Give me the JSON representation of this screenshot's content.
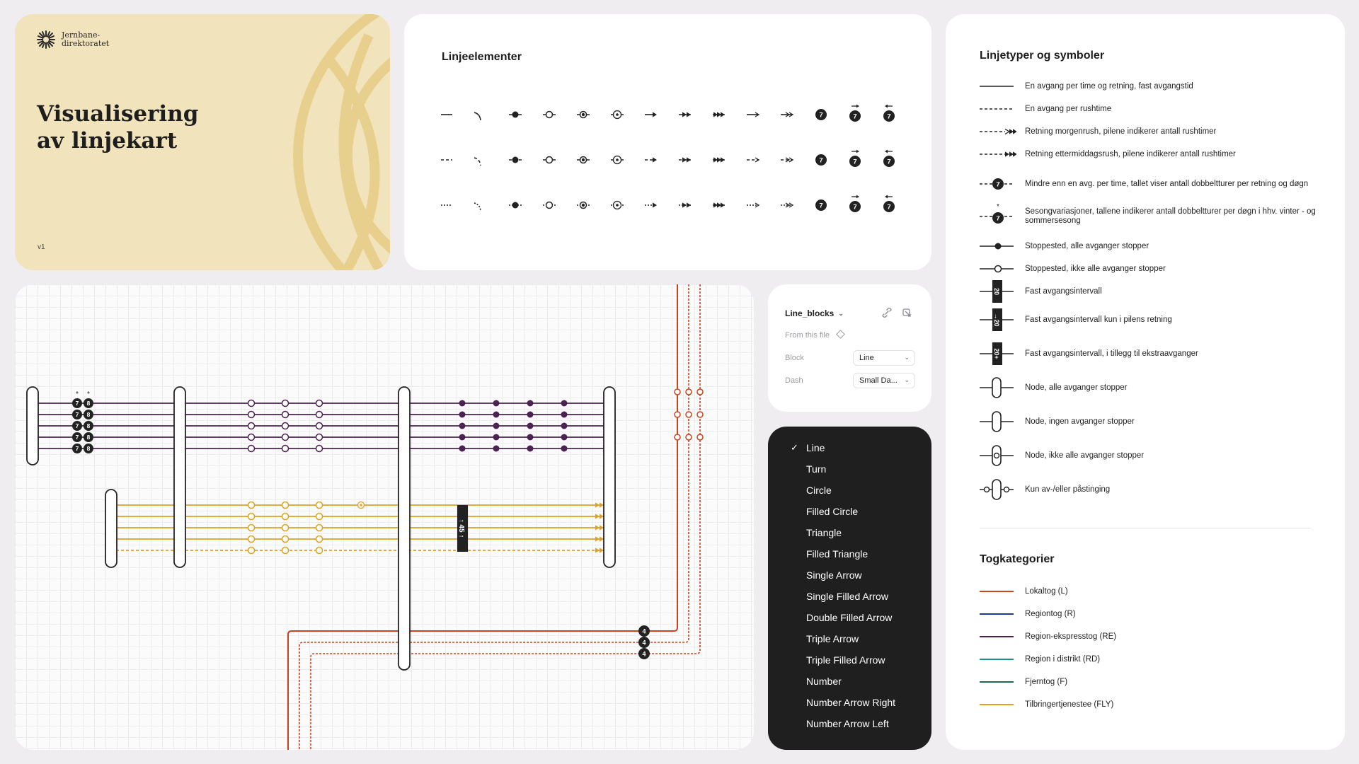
{
  "title_card": {
    "logo_line1": "Jernbane-",
    "logo_line2": "direktoratet",
    "title_line1": "Visualisering",
    "title_line2": "av linjekart",
    "version": "v1",
    "background": "#f1e3bb"
  },
  "elements_card": {
    "title": "Linjeelementer",
    "number_symbol": "7"
  },
  "legend": {
    "line_types_title": "Linjetyper og symboler",
    "line_types": [
      {
        "icon": "solid-line-icon",
        "text": "En avgang per time og retning, fast avgangstid"
      },
      {
        "icon": "dashed-line-icon",
        "text": "En avgang per rushtime"
      },
      {
        "icon": "morning-rush-arrows-icon",
        "text": "Retning morgenrush, pilene indikerer antall rushtimer"
      },
      {
        "icon": "evening-rush-arrows-icon",
        "text": "Retning ettermiddagsrush, pilene indikerer antall rushtimer"
      },
      {
        "icon": "number-circle-icon",
        "text": "Mindre enn en avg. per time, tallet viser antall dobbeltturer per retning og døgn"
      },
      {
        "icon": "seasonal-number-icon",
        "text": "Sesongvariasjoner, tallene indikerer antall dobbeltturer per døgn i hhv. vinter - og sommersesong"
      },
      {
        "icon": "filled-stop-icon",
        "text": "Stoppested, alle avganger stopper"
      },
      {
        "icon": "open-stop-icon",
        "text": "Stoppested, ikke alle avganger stopper"
      },
      {
        "icon": "fixed-interval-icon",
        "text": "Fast avgangsintervall"
      },
      {
        "icon": "fixed-interval-direction-icon",
        "text": "Fast avgangsintervall kun i pilens retning"
      },
      {
        "icon": "fixed-interval-extra-icon",
        "text": "Fast avgangsintervall, i tillegg til ekstraavganger"
      },
      {
        "icon": "node-all-stop-icon",
        "text": "Node, alle avganger stopper"
      },
      {
        "icon": "node-no-stop-icon",
        "text": "Node, ingen avganger stopper"
      },
      {
        "icon": "node-some-stop-icon",
        "text": "Node, ikke alle avganger stopper"
      },
      {
        "icon": "node-board-alight-icon",
        "text": "Kun av-/eller påstinging"
      }
    ],
    "interval_label": "20",
    "seasonal_star": "*",
    "categories_title": "Togkategorier",
    "categories": [
      {
        "color": "#c8431e",
        "text": "Lokaltog (L)"
      },
      {
        "color": "#1d3a8a",
        "text": "Regiontog (R)"
      },
      {
        "color": "#4b2352",
        "text": "Region-ekspresstog (RE)"
      },
      {
        "color": "#1e8c8c",
        "text": "Region i distrikt (RD)"
      },
      {
        "color": "#1e6b4a",
        "text": "Fjerntog (F)"
      },
      {
        "color": "#e0a020",
        "text": "Tilbringertjenestee (FLY)"
      }
    ]
  },
  "canvas": {
    "numbers_row1": [
      "7",
      "8"
    ],
    "interval_label": "45",
    "node_number": "4",
    "colors": {
      "purple": "#4b2352",
      "yellow": "#e0a020",
      "red": "#c8431e"
    }
  },
  "props": {
    "component_name": "Line_blocks",
    "source": "From this file",
    "block_label": "Block",
    "block_value": "Line",
    "dash_label": "Dash",
    "dash_value": "Small Da..."
  },
  "menu": {
    "items": [
      "Line",
      "Turn",
      "Circle",
      "Filled Circle",
      "Triangle",
      "Filled Triangle",
      "Single Arrow",
      "Single Filled Arrow",
      "Double Filled Arrow",
      "Triple Arrow",
      "Triple Filled Arrow",
      "Number",
      "Number Arrow Right",
      "Number Arrow Left"
    ],
    "selected_index": 0
  }
}
